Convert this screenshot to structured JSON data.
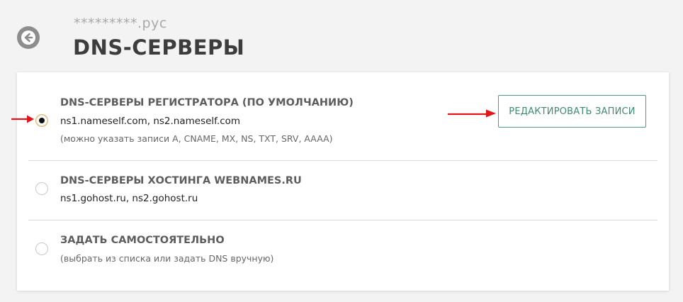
{
  "header": {
    "domain": "*********.рус",
    "title": "DNS-СЕРВЕРЫ",
    "back_icon": "arrow-left-circle-icon"
  },
  "options": [
    {
      "title": "DNS-СЕРВЕРЫ РЕГИСТРАТОРА (ПО УМОЛЧАНИЮ)",
      "servers": "ns1.nameself.com, ns2.nameself.com",
      "hint": "(можно указать записи A, CNAME, MX, NS, TXT, SRV, AAAA)",
      "selected": true,
      "action_label": "РЕДАКТИРОВАТЬ ЗАПИСИ"
    },
    {
      "title": "DNS-СЕРВЕРЫ ХОСТИНГА WEBNAMES.RU",
      "servers": "ns1.gohost.ru, ns2.gohost.ru",
      "selected": false
    },
    {
      "title": "ЗАДАТЬ САМОСТОЯТЕЛЬНО",
      "hint": "(выбрать из списка или задать DNS вручную)",
      "selected": false
    }
  ],
  "colors": {
    "annotation_arrow": "#e3151a",
    "accent_button": "#3f8a72",
    "radio_selected_ring": "#e0b574"
  },
  "annotations": [
    "red-arrow-icon",
    "red-arrow-icon"
  ]
}
